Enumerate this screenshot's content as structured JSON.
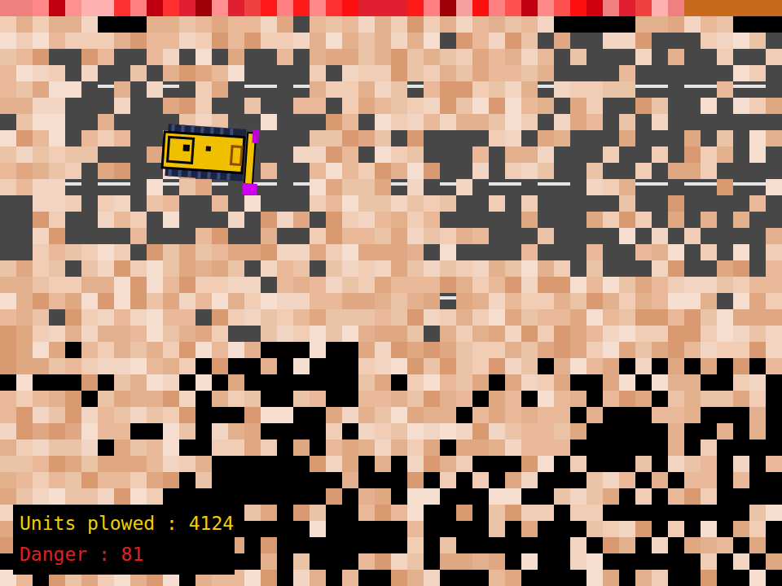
{
  "hud": {
    "units": "Units plowed : 4124",
    "danger": "Danger : 81"
  },
  "player": {
    "heading": "east"
  }
}
